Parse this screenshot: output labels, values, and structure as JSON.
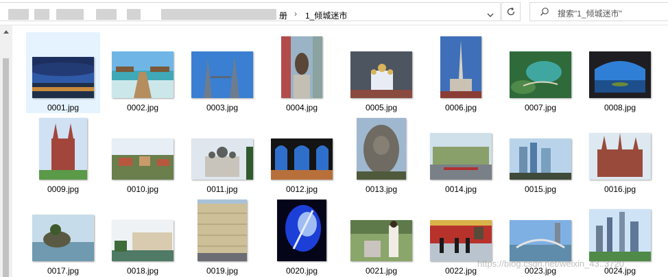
{
  "address_bar": {
    "path_tail": "册",
    "separator": "›",
    "current_folder": "1_倾城迷市",
    "dropdown_icon": "chevron-down-icon",
    "refresh_icon": "refresh-icon"
  },
  "search": {
    "placeholder": "搜索\"1_倾城迷市\"",
    "icon": "search-icon"
  },
  "watermark": "https://blog.csdn.net/weixin_43..3720",
  "files": [
    {
      "name": "0001.jpg",
      "selected": true
    },
    {
      "name": "0002.jpg"
    },
    {
      "name": "0003.jpg"
    },
    {
      "name": "0004.jpg"
    },
    {
      "name": "0005.jpg"
    },
    {
      "name": "0006.jpg"
    },
    {
      "name": "0007.jpg"
    },
    {
      "name": "0008.jpg"
    },
    {
      "name": "0009.jpg"
    },
    {
      "name": "0010.jpg"
    },
    {
      "name": "0011.jpg"
    },
    {
      "name": "0012.jpg"
    },
    {
      "name": "0013.jpg"
    },
    {
      "name": "0014.jpg"
    },
    {
      "name": "0015.jpg"
    },
    {
      "name": "0016.jpg"
    },
    {
      "name": "0017.jpg"
    },
    {
      "name": "0018.jpg"
    },
    {
      "name": "0019.jpg"
    },
    {
      "name": "0020.jpg"
    },
    {
      "name": "0021.jpg"
    },
    {
      "name": "0022.jpg"
    },
    {
      "name": "0023.jpg"
    },
    {
      "name": "0024.jpg"
    }
  ]
}
